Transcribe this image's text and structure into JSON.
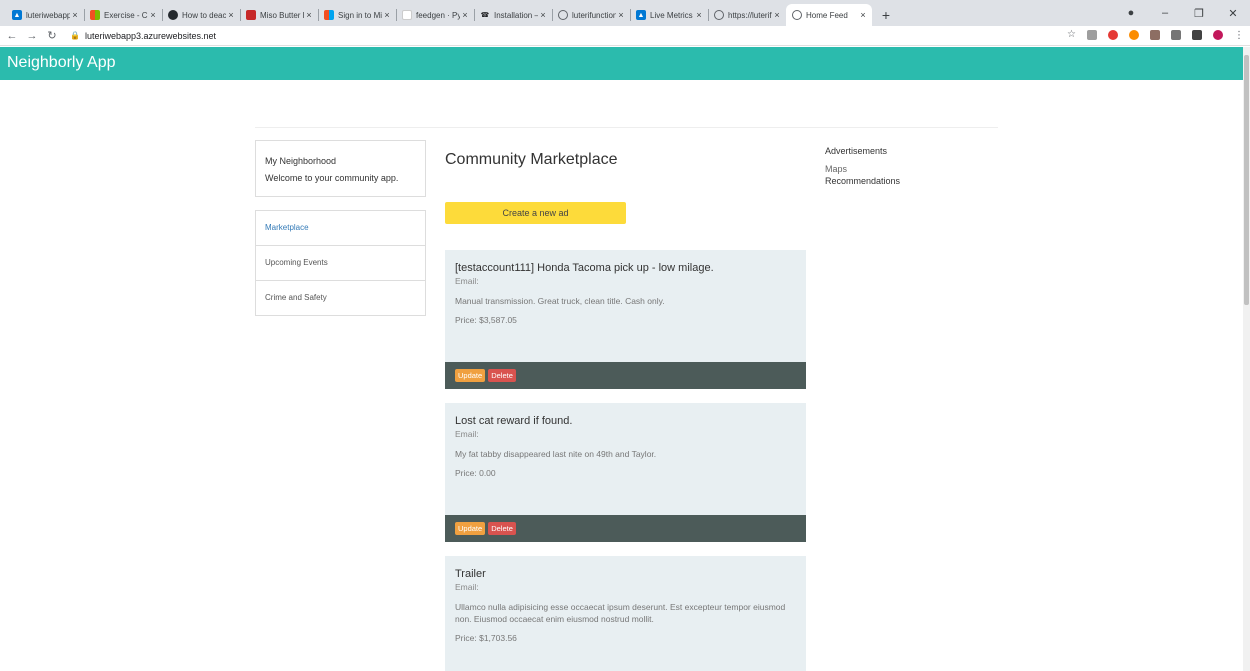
{
  "browser": {
    "tabs": [
      {
        "label": "luteriwebapp3 -",
        "icon_color": "#0078d4",
        "active": false
      },
      {
        "label": "Exercise - Config",
        "icon_color": "#f25022",
        "active": false
      },
      {
        "label": "How to deactiv",
        "icon_color": "#24292e",
        "active": false
      },
      {
        "label": "Miso Butter Pas",
        "icon_color": "#c62828",
        "active": false
      },
      {
        "label": "Sign in to Micro",
        "icon_color": "#f25022",
        "active": false
      },
      {
        "label": "feedgen · PyPI",
        "icon_color": "#ffffff",
        "active": false
      },
      {
        "label": "Installation — F",
        "icon_color": "#202124",
        "active": false
      },
      {
        "label": "luterifunctionap",
        "icon_color": "#5f6368",
        "active": false
      },
      {
        "label": "Live Metrics - M",
        "icon_color": "#0078d4",
        "active": false
      },
      {
        "label": "https://luterifun",
        "icon_color": "#5f6368",
        "active": false
      },
      {
        "label": "Home Feed",
        "icon_color": "#5f6368",
        "active": true
      }
    ],
    "close_glyph": "×",
    "new_tab_glyph": "+",
    "url": "luteriwebapp3.azurewebsites.net",
    "extensions": [
      "#9e9e9e",
      "#e53935",
      "#fb8c00",
      "#8d6e63",
      "#757575",
      "#424242",
      "#c2185b"
    ]
  },
  "app": {
    "brand": "Neighborly App",
    "sidebar": {
      "hood_title": "My Neighborhood",
      "hood_welcome": "Welcome to your community app.",
      "menu": [
        {
          "label": "Marketplace",
          "active": true
        },
        {
          "label": "Upcoming Events",
          "active": false
        },
        {
          "label": "Crime and Safety",
          "active": false
        }
      ]
    },
    "main": {
      "title": "Community Marketplace",
      "create_label": "Create a new ad",
      "update_label": "Update",
      "delete_label": "Delete",
      "ads": [
        {
          "title": "[testaccount111] Honda Tacoma pick up - low milage.",
          "email_label": "Email:",
          "description": "Manual transmission. Great truck, clean title. Cash only.",
          "price": "Price: $3,587.05"
        },
        {
          "title": "Lost cat reward if found.",
          "email_label": "Email:",
          "description": "My fat tabby disappeared last nite on 49th and Taylor.",
          "price": "Price: 0.00"
        },
        {
          "title": "Trailer",
          "email_label": "Email:",
          "description": "Ullamco nulla adipisicing esse occaecat ipsum deserunt. Est excepteur tempor eiusmod non. Eiusmod occaecat enim eiusmod nostrud mollit.",
          "price": "Price: $1,703.56"
        }
      ]
    },
    "right": {
      "heading": "Advertisements",
      "maps": "Maps",
      "recommendations": "Recommendations"
    }
  }
}
